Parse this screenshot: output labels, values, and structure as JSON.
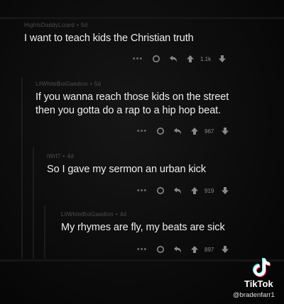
{
  "comments": [
    {
      "username": "HighIsDaddyLizard",
      "age": "5d",
      "text": [
        "I want to teach kids the Christian truth"
      ],
      "score": "1.1k"
    },
    {
      "username": "LilWhiteBoiGaedion",
      "age": "5d",
      "text": [
        "If you wanna reach those kids on the street",
        "then you gotta do a rap to a hip hop beat."
      ],
      "score": "967"
    },
    {
      "username": "iWrf7",
      "age": "4d",
      "text": [
        "So I gave my sermon an urban kick"
      ],
      "score": "919"
    },
    {
      "username": "LilWhiteBoiGaedion",
      "age": "4d",
      "text": [
        "My rhymes are fly, my beats are sick"
      ],
      "score": "897"
    }
  ],
  "watermark": {
    "brand": "TikTok",
    "handle": "@bradenfarr1"
  },
  "icons": [
    "more-icon",
    "award-icon",
    "reply-icon",
    "upvote-icon",
    "downvote-icon",
    "tiktok-logo-icon"
  ],
  "colors": {
    "background": "#0c0c0c",
    "text": "#eeeeee",
    "meta": "#4d4d4d",
    "action": "#8a8a8a"
  }
}
